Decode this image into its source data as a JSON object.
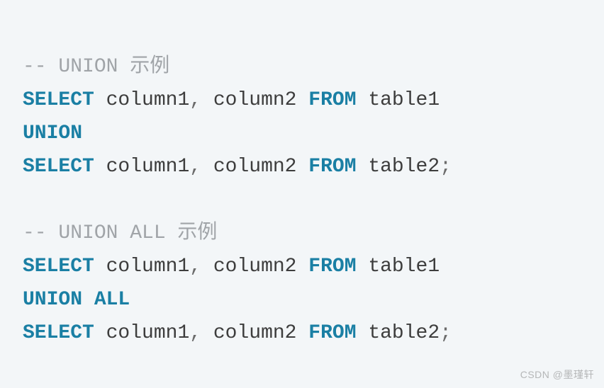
{
  "code": {
    "line1_comment": "-- UNION 示例",
    "line2_select": "SELECT",
    "line2_cols": " column1",
    "line2_comma": ",",
    "line2_cols2": " column2 ",
    "line2_from": "FROM",
    "line2_table": " table1",
    "line3_union": "UNION",
    "line4_select": "SELECT",
    "line4_cols": " column1",
    "line4_comma": ",",
    "line4_cols2": " column2 ",
    "line4_from": "FROM",
    "line4_table": " table2",
    "line4_semi": ";",
    "line6_comment": "-- UNION ALL 示例",
    "line7_select": "SELECT",
    "line7_cols": " column1",
    "line7_comma": ",",
    "line7_cols2": " column2 ",
    "line7_from": "FROM",
    "line7_table": " table1",
    "line8_unionall": "UNION ALL",
    "line9_select": "SELECT",
    "line9_cols": " column1",
    "line9_comma": ",",
    "line9_cols2": " column2 ",
    "line9_from": "FROM",
    "line9_table": " table2",
    "line9_semi": ";"
  },
  "watermark": "CSDN @墨瑾轩"
}
